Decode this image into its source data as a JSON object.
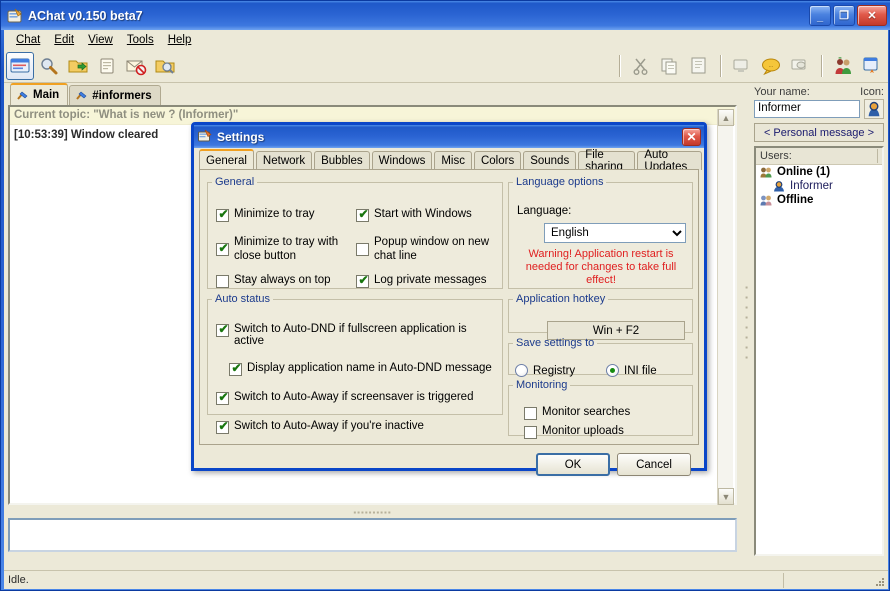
{
  "window": {
    "title": "AChat v0.150 beta7",
    "icon": "achat-app-icon",
    "min_label": "_",
    "max_label": "❐",
    "close_label": "✕"
  },
  "menu": [
    {
      "label": "Chat"
    },
    {
      "label": "Edit"
    },
    {
      "label": "View"
    },
    {
      "label": "Tools"
    },
    {
      "label": "Help"
    }
  ],
  "toolbar": {
    "left_icons": [
      "chat-window-icon",
      "search-users-icon",
      "open-folder-icon",
      "clipboard-notes-icon",
      "blocked-mail-icon",
      "folder-search-icon"
    ],
    "right_icons": [
      "cut-scissors-icon",
      "copy-icon",
      "paste-icon",
      "screen-disabled-icon",
      "speech-bubble-icon",
      "screen-message-icon",
      "users-group-icon",
      "rocket-window-icon"
    ]
  },
  "chat": {
    "tabs": [
      {
        "label": "Main",
        "icon": "broom-icon",
        "active": true
      },
      {
        "label": "#informers",
        "icon": "broom-icon",
        "active": false
      }
    ],
    "topic": "Current topic: \"What is new ? (Informer)\"",
    "log": [
      {
        "text": "[10:53:39] Window cleared"
      }
    ],
    "scroll_up": "▲",
    "scroll_down": "▼",
    "message_input_value": "",
    "message_input_placeholder": ""
  },
  "right_panel": {
    "your_name_label": "Your name:",
    "icon_label": "Icon:",
    "name_value": "Informer",
    "name_placeholder": "",
    "user_icon": "user-blue-hood-icon",
    "personal_message_button": "< Personal message >",
    "users_header": "Users:",
    "users": [
      {
        "label": "Online  (1)",
        "icon": "users-group-icon",
        "type": "group"
      },
      {
        "label": "Informer",
        "icon": "user-blue-hood-icon",
        "type": "child"
      },
      {
        "label": "Offline",
        "icon": "users-group-icon",
        "type": "group"
      }
    ]
  },
  "statusbar": {
    "pane1": "Idle.",
    "pane2": ""
  },
  "dialog": {
    "title": "Settings",
    "icon": "settings-window-icon",
    "close_label": "✕",
    "tabs": [
      {
        "label": "General",
        "active": true
      },
      {
        "label": "Network",
        "active": false
      },
      {
        "label": "Bubbles",
        "active": false
      },
      {
        "label": "Windows",
        "active": false
      },
      {
        "label": "Misc",
        "active": false
      },
      {
        "label": "Colors",
        "active": false
      },
      {
        "label": "Sounds",
        "active": false
      },
      {
        "label": "File sharing",
        "active": false
      },
      {
        "label": "Auto Updates",
        "active": false
      }
    ],
    "general_group": {
      "legend": "General",
      "left_items": [
        {
          "label": "Minimize to tray",
          "checked": true
        },
        {
          "label": "Minimize to tray with close button",
          "checked": true
        },
        {
          "label": "Stay always on top",
          "checked": false
        }
      ],
      "right_items": [
        {
          "label": "Start with Windows",
          "checked": true
        },
        {
          "label": "Popup window on new chat line",
          "checked": false
        },
        {
          "label": "Log private messages",
          "checked": true
        }
      ]
    },
    "auto_status_group": {
      "legend": "Auto status",
      "items": [
        {
          "label": "Switch to Auto-DND if fullscreen application is active",
          "checked": true,
          "indent": false
        },
        {
          "label": "Display application name in Auto-DND message",
          "checked": true,
          "indent": true
        },
        {
          "label": "Switch to Auto-Away if screensaver is triggered",
          "checked": true,
          "indent": false
        },
        {
          "label": "Switch to Auto-Away if you're inactive",
          "checked": true,
          "indent": false
        }
      ]
    },
    "language_group": {
      "legend": "Language options",
      "field_label": "Language:",
      "selected": "English",
      "options": [
        "English"
      ],
      "warning": "Warning! Application restart is needed for changes to take full effect!",
      "warning_color": "#e02020"
    },
    "hotkey_group": {
      "legend": "Application hotkey",
      "value": "Win + F2"
    },
    "save_group": {
      "legend": "Save settings to",
      "options": [
        {
          "label": "Registry",
          "selected": false
        },
        {
          "label": "INI file",
          "selected": true
        }
      ]
    },
    "monitoring_group": {
      "legend": "Monitoring",
      "items": [
        {
          "label": "Monitor searches",
          "checked": false
        },
        {
          "label": "Monitor uploads",
          "checked": false
        }
      ]
    },
    "ok_label": "OK",
    "cancel_label": "Cancel"
  },
  "colors": {
    "titlebar_blue": "#1f59c9",
    "dialog_border": "#0a46c8",
    "face": "#ece9d8",
    "active_tab_accent": "#f0a021",
    "group_legend": "#1b3a8c",
    "warning": "#e02020",
    "topic_bg": "#f7f5d8"
  }
}
